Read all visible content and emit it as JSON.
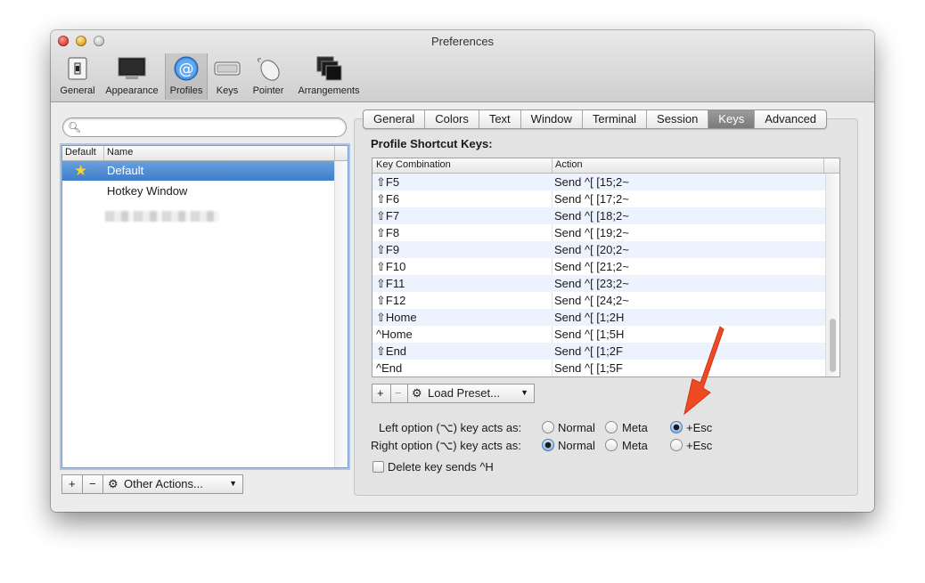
{
  "window": {
    "title": "Preferences"
  },
  "toolbar": {
    "items": [
      {
        "label": "General",
        "icon": "switch-icon"
      },
      {
        "label": "Appearance",
        "icon": "monitor-icon"
      },
      {
        "label": "Profiles",
        "icon": "at-sign-icon",
        "selected": true
      },
      {
        "label": "Keys",
        "icon": "keyboard-icon"
      },
      {
        "label": "Pointer",
        "icon": "mouse-icon"
      },
      {
        "label": "Arrangements",
        "icon": "windows-icon"
      }
    ]
  },
  "sidebar": {
    "search": {
      "value": "",
      "placeholder": ""
    },
    "columns": {
      "default": "Default",
      "name": "Name"
    },
    "profiles": [
      {
        "name": "Default",
        "is_default": true,
        "selected": true
      },
      {
        "name": "Hotkey Window",
        "is_default": false,
        "selected": false
      }
    ],
    "add_label": "+",
    "remove_label": "−",
    "other_actions_label": "Other Actions..."
  },
  "tabs": [
    {
      "label": "General"
    },
    {
      "label": "Colors"
    },
    {
      "label": "Text"
    },
    {
      "label": "Window"
    },
    {
      "label": "Terminal"
    },
    {
      "label": "Session"
    },
    {
      "label": "Keys",
      "selected": true
    },
    {
      "label": "Advanced"
    }
  ],
  "keys": {
    "section_title": "Profile Shortcut Keys:",
    "columns": {
      "combo": "Key Combination",
      "action": "Action"
    },
    "rows": [
      {
        "combo": "⇧F5",
        "action": "Send ^[ [15;2~"
      },
      {
        "combo": "⇧F6",
        "action": "Send ^[ [17;2~"
      },
      {
        "combo": "⇧F7",
        "action": "Send ^[ [18;2~"
      },
      {
        "combo": "⇧F8",
        "action": "Send ^[ [19;2~"
      },
      {
        "combo": "⇧F9",
        "action": "Send ^[ [20;2~"
      },
      {
        "combo": "⇧F10",
        "action": "Send ^[ [21;2~"
      },
      {
        "combo": "⇧F11",
        "action": "Send ^[ [23;2~"
      },
      {
        "combo": "⇧F12",
        "action": "Send ^[ [24;2~"
      },
      {
        "combo": "⇧Home",
        "action": "Send ^[ [1;2H"
      },
      {
        "combo": "^Home",
        "action": "Send ^[ [1;5H"
      },
      {
        "combo": "⇧End",
        "action": "Send ^[ [1;2F"
      },
      {
        "combo": "^End",
        "action": "Send ^[ [1;5F"
      }
    ],
    "add_label": "+",
    "remove_label": "−",
    "load_preset_label": "Load Preset..."
  },
  "options": {
    "left_label": "Left option (⌥) key acts as:",
    "right_label": "Right option (⌥) key acts as:",
    "choices": [
      "Normal",
      "Meta",
      "+Esc"
    ],
    "left_selected": "+Esc",
    "right_selected": "Normal",
    "delete_label": "Delete key sends ^H",
    "delete_checked": false
  },
  "colors": {
    "selection_blue": "#3f7ecb",
    "annotation_arrow": "#f04a22"
  }
}
